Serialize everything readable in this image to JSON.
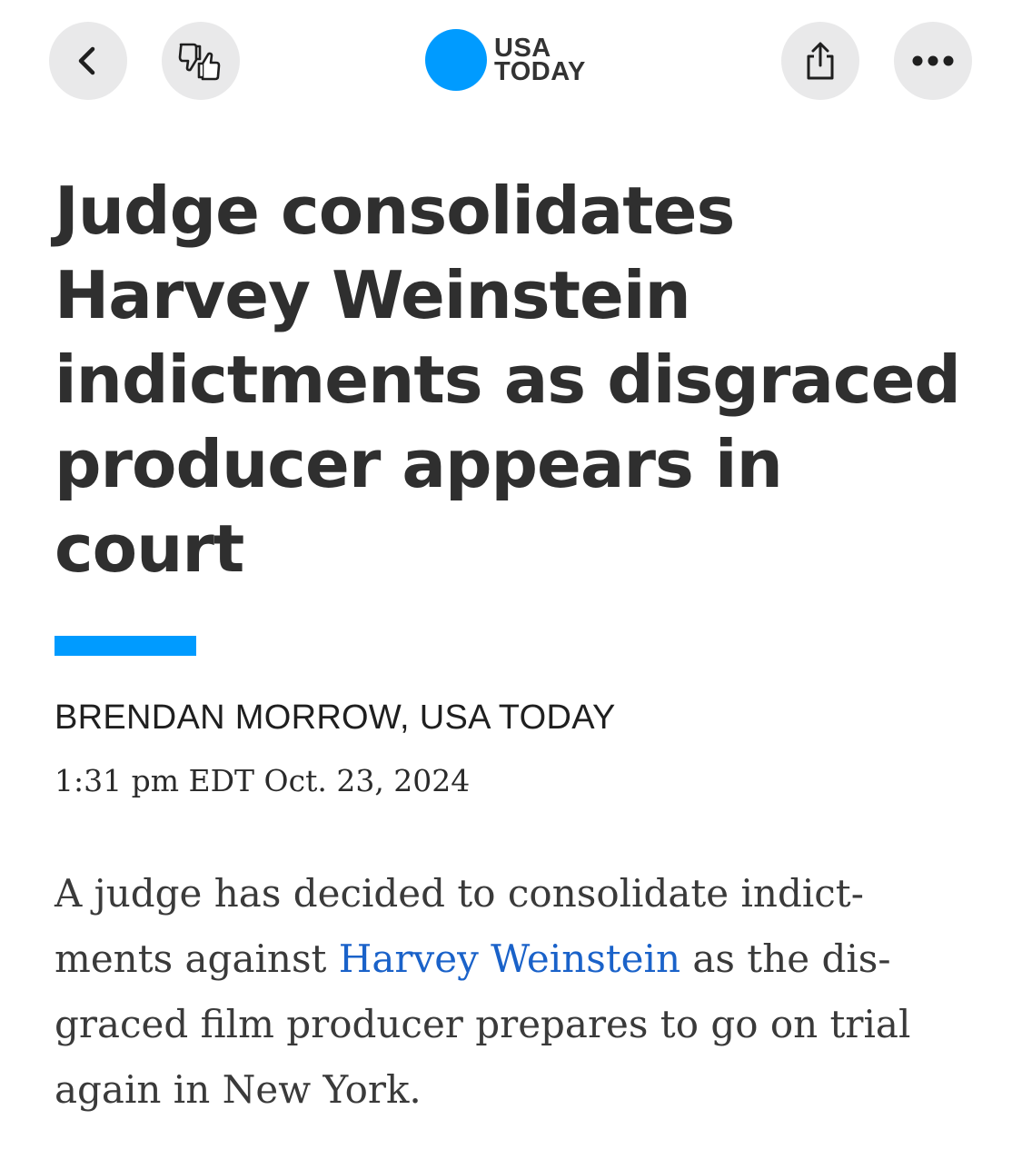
{
  "topbar": {
    "back_icon": "chevron-left-icon",
    "reactions_icon": "thumbs-up-down-icon",
    "share_icon": "share-icon",
    "more_icon": "ellipsis-icon",
    "logo": {
      "line1": "USA",
      "line2": "TODAY",
      "dot_color": "#009bff"
    }
  },
  "article": {
    "headline": "Judge consolidates Harvey Weinstein indictments as disgraced producer appears in court",
    "accent_color": "#009bff",
    "byline": "BRENDAN MORROW, USA TODAY",
    "dateline": "1:31 pm EDT Oct. 23, 2024",
    "body": {
      "line1": "A judge has decided to consolidate indict-",
      "line2_before": "ments against ",
      "line2_link": "Harvey Weinstein",
      "line2_after": " as the dis-",
      "line3": "graced film producer prepares to go on trial",
      "line4": "again in New York."
    },
    "link_color": "#1a62c9"
  }
}
